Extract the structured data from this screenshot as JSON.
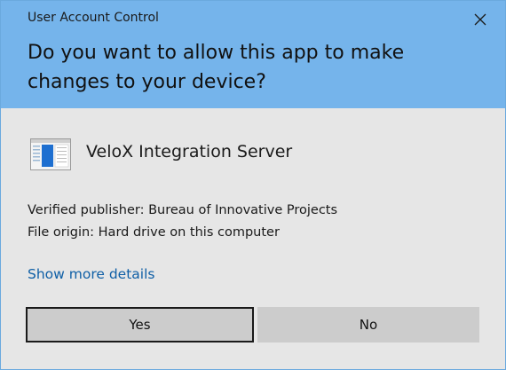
{
  "window": {
    "title": "User Account Control",
    "close_icon": "close-icon"
  },
  "prompt": {
    "question": "Do you want to allow this app to make changes to your device?"
  },
  "app": {
    "icon": "app-window-icon",
    "name": "VeloX Integration Server"
  },
  "info": {
    "publisher": "Verified publisher: Bureau of Innovative Projects",
    "origin": "File origin: Hard drive on this computer"
  },
  "details_link": "Show more details",
  "buttons": {
    "yes": "Yes",
    "no": "No"
  },
  "colors": {
    "header_bg": "#75b4eb",
    "body_bg": "#e6e6e6",
    "link": "#0f5fa6",
    "button_bg": "#cccccc"
  }
}
